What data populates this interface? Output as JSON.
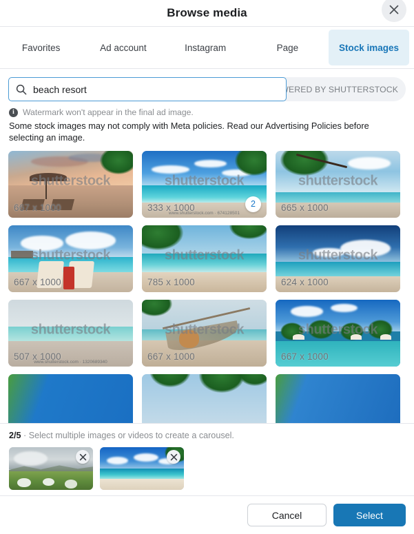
{
  "header": {
    "title": "Browse media",
    "close_label": "Close"
  },
  "tabs": [
    {
      "label": "Favorites",
      "active": false
    },
    {
      "label": "Ad account",
      "active": false
    },
    {
      "label": "Instagram",
      "active": false
    },
    {
      "label": "Page",
      "active": false
    },
    {
      "label": "Stock images",
      "active": true
    }
  ],
  "search": {
    "value": "beach resort",
    "placeholder": "Search",
    "powered_by": "POWERED BY SHUTTERSTOCK"
  },
  "notices": {
    "watermark": "Watermark won't appear in the final ad image.",
    "info_glyph": "i",
    "policy": "Some stock images may not comply with Meta policies. Read our Advertising Policies before selecting an image."
  },
  "grid": {
    "watermark_text": "shutterstock",
    "tiles": [
      {
        "dimensions": "667 x 1000",
        "scene": "sunset-umbrella-beach",
        "selected": false,
        "badge": null,
        "url": null
      },
      {
        "dimensions": "333 x 1000",
        "scene": "turquoise-palm-beach",
        "selected": false,
        "badge": "2",
        "url": "www.shutterstock.com · 674128501"
      },
      {
        "dimensions": "665 x 1000",
        "scene": "leaning-palm-beach",
        "selected": false,
        "badge": null,
        "url": null
      },
      {
        "dimensions": "667 x 1000",
        "scene": "loungers-overwater",
        "selected": false,
        "badge": null,
        "url": null
      },
      {
        "dimensions": "785 x 1000",
        "scene": "palm-frond-shore",
        "selected": false,
        "badge": null,
        "url": null
      },
      {
        "dimensions": "624 x 1000",
        "scene": "deep-blue-horizon",
        "selected": false,
        "badge": null,
        "url": null
      },
      {
        "dimensions": "507 x 1000",
        "scene": "pale-empty-beach",
        "selected": false,
        "badge": null,
        "url": "www.shutterstock.com · 1320689340"
      },
      {
        "dimensions": "667 x 1000",
        "scene": "hammock-beach",
        "selected": false,
        "badge": null,
        "url": null
      },
      {
        "dimensions": "667 x 1000",
        "scene": "pool-palms-resort",
        "selected": true,
        "badge": null,
        "url": null
      }
    ],
    "partial_row": [
      {
        "scene": "blue-water-strip"
      },
      {
        "scene": "palm-canopy-strip"
      },
      {
        "scene": "blue-gradient-strip"
      }
    ]
  },
  "tray": {
    "count": "2/5",
    "separator": "·",
    "hint": "Select multiple images or videos to create a carousel.",
    "thumbnails": [
      {
        "scene": "mountain-meadow",
        "remove_label": "Remove"
      },
      {
        "scene": "tropical-beach",
        "remove_label": "Remove"
      }
    ]
  },
  "footer": {
    "cancel_label": "Cancel",
    "select_label": "Select"
  },
  "colors": {
    "accent": "#1877b5",
    "active_tab_bg": "#e3f0f7",
    "active_tab_text": "#1876b8",
    "border": "#e4e6eb"
  }
}
